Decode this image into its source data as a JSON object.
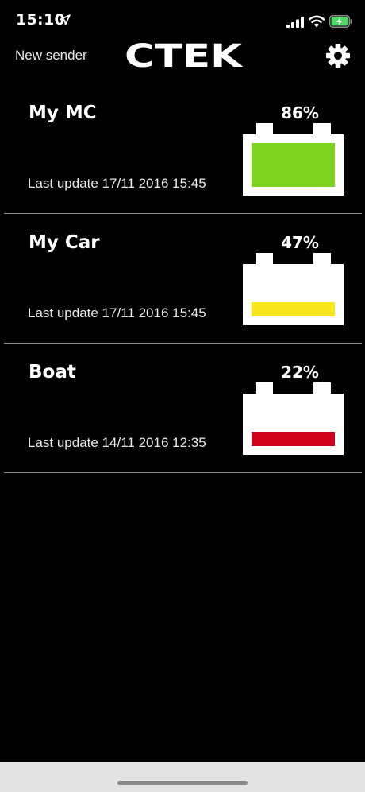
{
  "status_bar": {
    "time": "15:10",
    "icons": [
      "location-arrow-icon",
      "cellular-signal-icon",
      "wifi-icon",
      "battery-charging-icon"
    ],
    "battery_color": "#4cd964"
  },
  "header": {
    "left_label": "New sender",
    "logo_text": "CTEK",
    "settings_icon": "gear-icon"
  },
  "devices": [
    {
      "name": "My MC",
      "percent_label": "86%",
      "level": 0.86,
      "last_update": "Last update 17/11 2016 15:45",
      "level_color": "#7ed321"
    },
    {
      "name": "My Car",
      "percent_label": "47%",
      "level": 0.47,
      "last_update": "Last update 17/11 2016 15:45",
      "level_color": "#f8e71c"
    },
    {
      "name": "Boat",
      "percent_label": "22%",
      "level": 0.22,
      "last_update": "Last update 14/11 2016 12:35",
      "level_color": "#d0021b"
    }
  ]
}
